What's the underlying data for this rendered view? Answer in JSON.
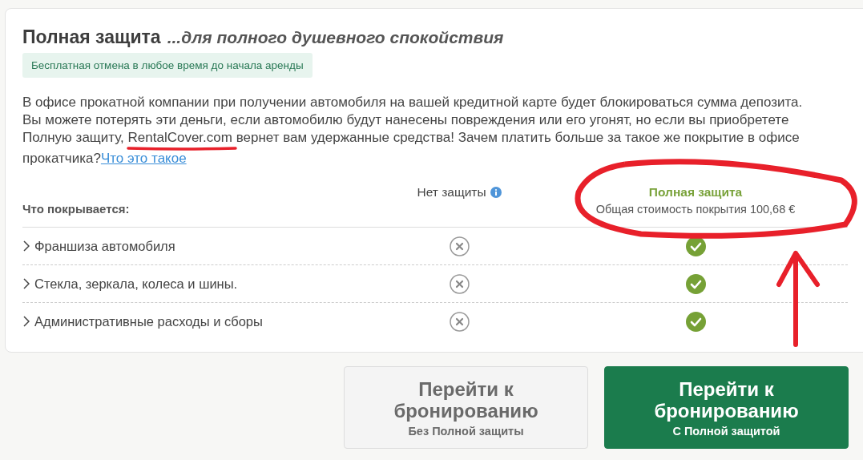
{
  "title": {
    "main": "Полная защита",
    "tagline": "...для полного душевного спокойствия"
  },
  "badge": "Бесплатная отмена в любое время до начала аренды",
  "description": {
    "lines": [
      "В офисе прокатной компании при получении автомобиля на вашей кредитной карте будет блокироваться сумма депозита.",
      "Вы можете потерять эти деньги, если автомобилю будут нанесены повреждения или его угонят, но если вы приобретете",
      "Полную защиту, RentalCover.com вернет вам удержанные средства! Зачем платить больше за такое же покрытие в офисе",
      "прокатчика?"
    ],
    "link": "Что это такое"
  },
  "table": {
    "columns": [
      {
        "label": "Что покрывается:"
      },
      {
        "label": "Нет защиты",
        "info": true
      },
      {
        "label": "Полная защита",
        "subtitle": "Общая стоимость покрытия 100,68 €"
      }
    ],
    "rows": [
      {
        "label": "Франшиза автомобиля",
        "basic_covered": false,
        "full_covered": true
      },
      {
        "label": "Стекла, зеркала, колеса и шины.",
        "basic_covered": false,
        "full_covered": true
      },
      {
        "label": "Административные расходы и сборы",
        "basic_covered": false,
        "full_covered": true
      }
    ]
  },
  "buttons": [
    {
      "kind": "secondary",
      "title": "Перейти к бронированию",
      "subtitle": "Без Полной защиты"
    },
    {
      "kind": "primary",
      "title": "Перейти к бронированию",
      "subtitle": "С Полной защитой"
    }
  ]
}
